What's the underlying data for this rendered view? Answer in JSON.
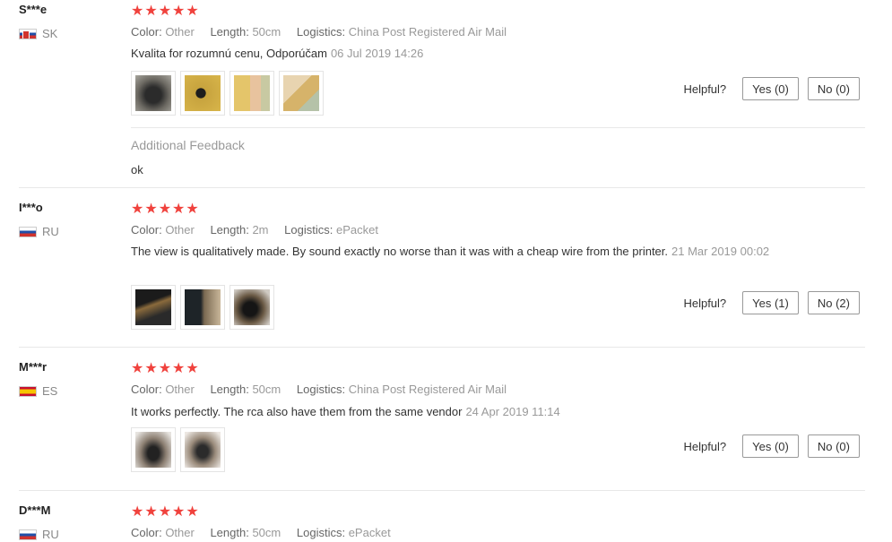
{
  "labels": {
    "color": "Color:",
    "length": "Length:",
    "logistics": "Logistics:",
    "helpful": "Helpful?",
    "additional_feedback": "Additional Feedback"
  },
  "stars": "★★★★★",
  "reviews": [
    {
      "user": "S***e",
      "country": "SK",
      "color": "Other",
      "length": "50cm",
      "logistics": "China Post Registered Air Mail",
      "text": "Kvalita for rozumnú cenu, Odporúčam",
      "date": "06 Jul 2019 14:26",
      "yes": "Yes (0)",
      "no": "No (0)",
      "feedback": "ok"
    },
    {
      "user": "I***o",
      "country": "RU",
      "color": "Other",
      "length": "2m",
      "logistics": "ePacket",
      "text": "The view is qualitatively made. By sound exactly no worse than it was with a cheap wire from the printer.",
      "date": "21 Mar 2019 00:02",
      "yes": "Yes (1)",
      "no": "No (2)"
    },
    {
      "user": "M***r",
      "country": "ES",
      "color": "Other",
      "length": "50cm",
      "logistics": "China Post Registered Air Mail",
      "text": "It works perfectly. The rca also have them from the same vendor",
      "date": "24 Apr 2019 11:14",
      "yes": "Yes (0)",
      "no": "No (0)"
    },
    {
      "user": "D***M",
      "country": "RU",
      "color": "Other",
      "length": "50cm",
      "logistics": "ePacket"
    }
  ]
}
